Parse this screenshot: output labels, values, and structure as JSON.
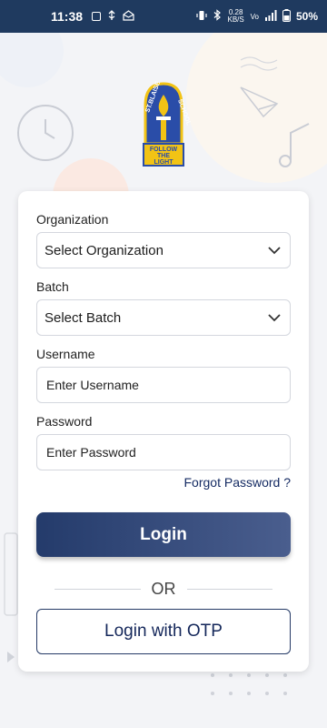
{
  "status_bar": {
    "time": "11:38",
    "network_speed": "0.28 KB/S",
    "battery": "50%",
    "icons": [
      "sim-icon",
      "usb-icon",
      "email-icon",
      "vibrate-icon",
      "bluetooth-icon",
      "network-speed-icon",
      "volte-icon",
      "signal-icon",
      "battery-icon"
    ]
  },
  "logo": {
    "top_text": "ST. BLAISE SCHOOL",
    "motto": "FOLLOW THE LIGHT"
  },
  "form": {
    "organization_label": "Organization",
    "organization_value": "Select Organization",
    "batch_label": "Batch",
    "batch_value": "Select Batch",
    "username_label": "Username",
    "username_placeholder": "Enter Username",
    "password_label": "Password",
    "password_placeholder": "Enter Password",
    "forgot_password": "Forgot Password ?",
    "login_button": "Login",
    "or_text": "OR",
    "otp_button": "Login with OTP"
  },
  "colors": {
    "status_bar_bg": "#1f3a5f",
    "primary": "#243b6b",
    "primary_light": "#4a5e8e",
    "text_link": "#152b63"
  }
}
